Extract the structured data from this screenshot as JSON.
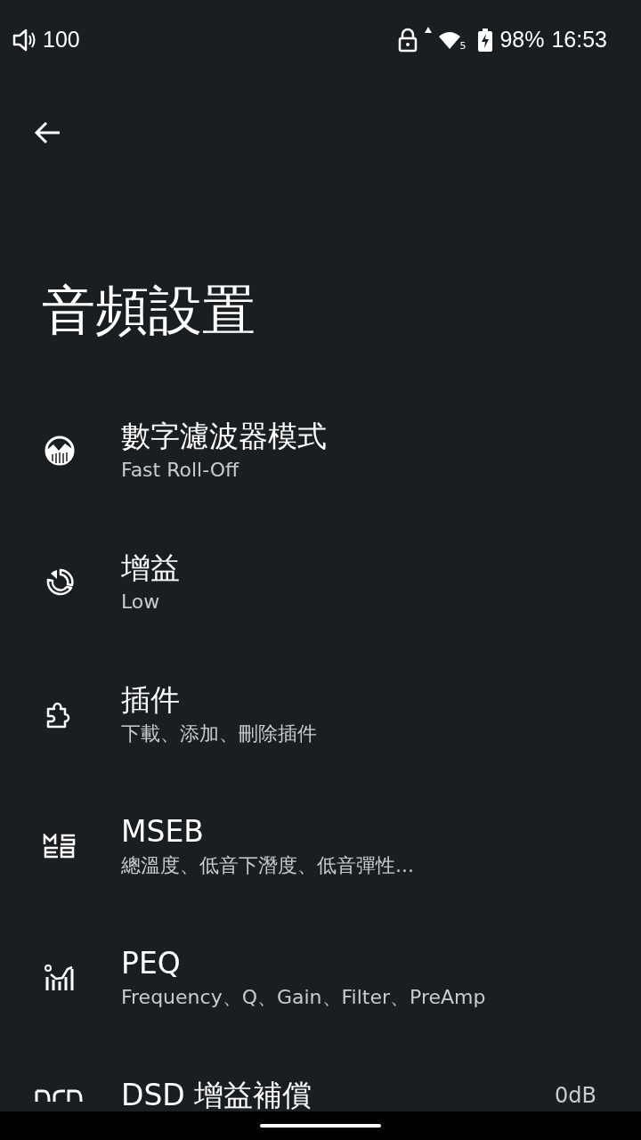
{
  "status_bar": {
    "volume": "100",
    "wifi_badge": "5",
    "battery": "98%",
    "time": "16:53"
  },
  "title": "音頻設置",
  "items": [
    {
      "title": "數字濾波器模式",
      "subtitle": "Fast Roll-Off"
    },
    {
      "title": "增益",
      "subtitle": "Low"
    },
    {
      "title": "插件",
      "subtitle": "下載、添加、刪除插件"
    },
    {
      "title": "MSEB",
      "subtitle": "總溫度、低音下潛度、低音彈性..."
    },
    {
      "title": "PEQ",
      "subtitle": "Frequency、Q、Gain、Filter、PreAmp"
    },
    {
      "title": "DSD 增益補償",
      "value": "0dB"
    }
  ]
}
